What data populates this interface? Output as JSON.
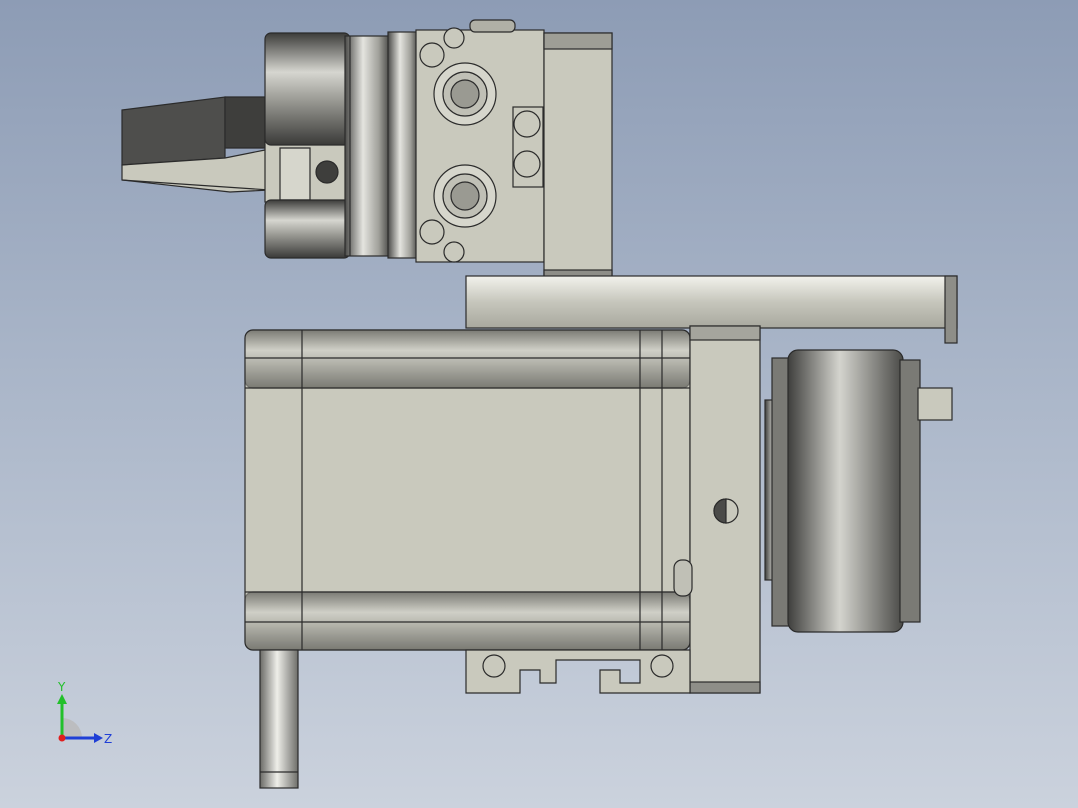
{
  "triad": {
    "y_label": "Y",
    "z_label": "Z",
    "colors": {
      "y": "#22c02a",
      "z": "#1f3fd6",
      "x": "#e01e1e"
    }
  },
  "model": {
    "colors": {
      "body": "#c9c9bd",
      "edge": "#2b2b2b",
      "dark": "#4a4a48",
      "mid": "#8e8e88",
      "steel": "#d9d9d4"
    }
  }
}
